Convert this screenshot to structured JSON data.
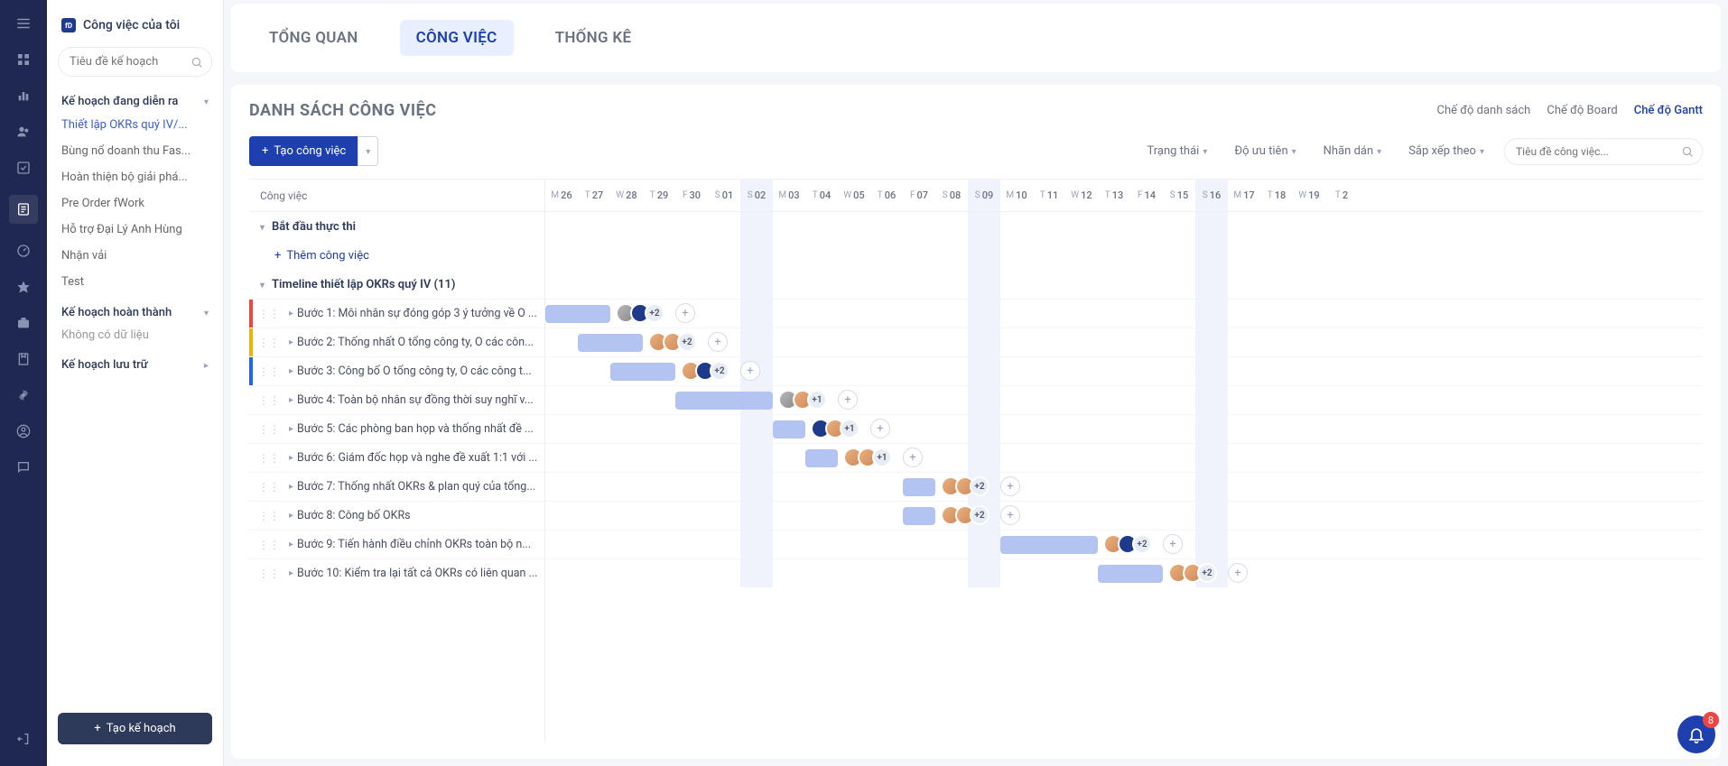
{
  "sidebar": {
    "title": "Công việc của tôi",
    "search_placeholder": "Tiêu đề kế hoạch",
    "sections": {
      "active": {
        "label": "Kế hoạch đang diễn ra",
        "items": [
          "Thiết lập OKRs quý IV/...",
          "Bùng nổ doanh thu Fas...",
          "Hoàn thiện bộ giải phá...",
          "Pre Order fWork",
          "Hỗ trợ Đại Lý Anh Hùng",
          "Nhận vải",
          "Test"
        ]
      },
      "done": {
        "label": "Kế hoạch hoàn thành",
        "nodata": "Không có dữ liệu"
      },
      "archived": {
        "label": "Kế hoạch lưu trữ"
      }
    },
    "create_plan": "Tạo kế hoạch"
  },
  "tabs": {
    "overview": "TỔNG QUAN",
    "jobs": "CÔNG VIỆC",
    "stats": "THỐNG KÊ"
  },
  "card": {
    "title": "DANH SÁCH CÔNG VIỆC",
    "views": {
      "list": "Chế độ danh sách",
      "board": "Chế độ Board",
      "gantt": "Chế độ Gantt"
    },
    "create_task": "Tạo công việc",
    "filters": {
      "status": "Trạng thái",
      "priority": "Độ ưu tiên",
      "label": "Nhãn dán",
      "sort": "Sắp xếp theo"
    },
    "task_search_placeholder": "Tiêu đề công việc..."
  },
  "gantt": {
    "left_header": "Công việc",
    "group1": "Bắt đầu thực thi",
    "add_task": "Thêm công việc",
    "group2": "Timeline thiết lập OKRs quý IV (11)",
    "tasks": [
      {
        "flag": "#ef4444",
        "name": "Bước 1: Môi nhân sự đóng góp 3 ý tưởng về O ...",
        "start": 0,
        "len": 2,
        "avatars": [
          "grey",
          "blue"
        ],
        "plus": "+2"
      },
      {
        "flag": "#eab308",
        "name": "Bước 2: Thống nhất O tổng công ty, O các côn...",
        "start": 1,
        "len": 2,
        "avatars": [
          "orange",
          "orange"
        ],
        "plus": "+2"
      },
      {
        "flag": "#2563eb",
        "name": "Bước 3: Công bố O tổng công ty, O các công t...",
        "start": 2,
        "len": 2,
        "avatars": [
          "orange",
          "blue"
        ],
        "plus": "+2"
      },
      {
        "flag": "",
        "name": "Bước 4: Toàn bộ nhân sự đồng thời suy nghĩ v...",
        "start": 4,
        "len": 3,
        "avatars": [
          "grey",
          "orange"
        ],
        "plus": "+1"
      },
      {
        "flag": "",
        "name": "Bước 5: Các phòng ban họp và thống nhất đề ...",
        "start": 7,
        "len": 1,
        "avatars": [
          "blue",
          "orange"
        ],
        "plus": "+1"
      },
      {
        "flag": "",
        "name": "Bước 6: Giám đốc họp và nghe đề xuất 1:1 với ...",
        "start": 8,
        "len": 1,
        "avatars": [
          "orange",
          "orange"
        ],
        "plus": "+1"
      },
      {
        "flag": "",
        "name": "Bước 7: Thống nhất OKRs & plan quý của tổng...",
        "start": 11,
        "len": 1,
        "avatars": [
          "orange",
          "orange"
        ],
        "plus": "+2"
      },
      {
        "flag": "",
        "name": "Bước 8: Công bố OKRs",
        "start": 11,
        "len": 1,
        "avatars": [
          "orange",
          "orange"
        ],
        "plus": "+2"
      },
      {
        "flag": "",
        "name": "Bước 9: Tiến hành điều chỉnh OKRs toàn bộ n...",
        "start": 14,
        "len": 3,
        "avatars": [
          "orange",
          "blue"
        ],
        "plus": "+2"
      },
      {
        "flag": "",
        "name": "Bước 10: Kiểm tra lại tất cả OKRs có liên quan ...",
        "start": 17,
        "len": 2,
        "avatars": [
          "orange",
          "orange"
        ],
        "plus": "+2"
      }
    ],
    "days": [
      {
        "dow": "M",
        "num": "26",
        "we": false
      },
      {
        "dow": "T",
        "num": "27",
        "we": false
      },
      {
        "dow": "W",
        "num": "28",
        "we": false
      },
      {
        "dow": "T",
        "num": "29",
        "we": false
      },
      {
        "dow": "F",
        "num": "30",
        "we": false
      },
      {
        "dow": "S",
        "num": "01",
        "we": false
      },
      {
        "dow": "S",
        "num": "02",
        "we": true
      },
      {
        "dow": "M",
        "num": "03",
        "we": false
      },
      {
        "dow": "T",
        "num": "04",
        "we": false
      },
      {
        "dow": "W",
        "num": "05",
        "we": false
      },
      {
        "dow": "T",
        "num": "06",
        "we": false
      },
      {
        "dow": "F",
        "num": "07",
        "we": false
      },
      {
        "dow": "S",
        "num": "08",
        "we": false
      },
      {
        "dow": "S",
        "num": "09",
        "we": true
      },
      {
        "dow": "M",
        "num": "10",
        "we": false
      },
      {
        "dow": "T",
        "num": "11",
        "we": false
      },
      {
        "dow": "W",
        "num": "12",
        "we": false
      },
      {
        "dow": "T",
        "num": "13",
        "we": false
      },
      {
        "dow": "F",
        "num": "14",
        "we": false
      },
      {
        "dow": "S",
        "num": "15",
        "we": false
      },
      {
        "dow": "S",
        "num": "16",
        "we": true
      },
      {
        "dow": "M",
        "num": "17",
        "we": false
      },
      {
        "dow": "T",
        "num": "18",
        "we": false
      },
      {
        "dow": "W",
        "num": "19",
        "we": false
      },
      {
        "dow": "T",
        "num": "2",
        "we": false
      }
    ]
  },
  "notif": {
    "count": "8"
  }
}
